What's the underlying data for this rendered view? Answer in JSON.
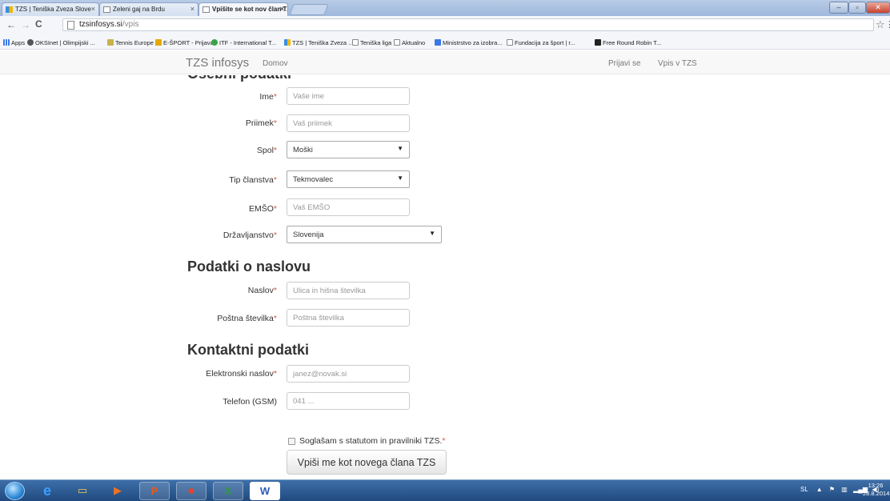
{
  "browser": {
    "tabs": [
      {
        "title": "TZS | Teniška Zveza Slove",
        "active": false
      },
      {
        "title": "Zeleni gaj na Brdu",
        "active": false
      },
      {
        "title": "Vpišite se kot nov član TZ",
        "active": true
      }
    ],
    "url_host": "tzsinfosys.si",
    "url_path": "/vpis",
    "bookmarks": [
      "Apps",
      "OKSInet | Olimpijski ...",
      "Tennis Europe",
      "E-ŠPORT - Prijava",
      "ITF - International T...",
      "TZS | Teniška Zveza ...",
      "Teniška liga",
      "Aktualno",
      "Ministrstvo za izobra...",
      "Fundacija za šport | r...",
      "Free Round Robin T..."
    ]
  },
  "navbar": {
    "brand": "TZS infosys",
    "home": "Domov",
    "login": "Prijavi se",
    "register": "Vpis v TZS"
  },
  "form": {
    "personal": {
      "heading": "Osebni podatki",
      "first_name": {
        "label": "Ime",
        "placeholder": "Vaše ime"
      },
      "last_name": {
        "label": "Priimek",
        "placeholder": "Vaš priimek"
      },
      "gender": {
        "label": "Spol",
        "value": "Moški"
      },
      "membership": {
        "label": "Tip članstva",
        "value": "Tekmovalec"
      },
      "emso": {
        "label": "EMŠO",
        "placeholder": "Vaš EMŠO"
      },
      "citizenship": {
        "label": "Državljanstvo",
        "value": "Slovenija"
      }
    },
    "address": {
      "heading": "Podatki o naslovu",
      "street": {
        "label": "Naslov",
        "placeholder": "Ulica in hišna številka"
      },
      "postal": {
        "label": "Poštna številka",
        "placeholder": "Poštna številka"
      }
    },
    "contact": {
      "heading": "Kontaktni podatki",
      "email": {
        "label": "Elektronski naslov",
        "placeholder": "janez@novak.si"
      },
      "phone": {
        "label": "Telefon (GSM)",
        "placeholder": "041 ..."
      }
    },
    "required_mark": "*",
    "agree_label": "Soglašam s statutom in pravilniki TZS.",
    "submit_label": "Vpiši me kot novega člana TZS"
  },
  "taskbar": {
    "language": "SL",
    "time": "13:26",
    "date": "28.8.2014"
  },
  "colors": {
    "required": "#d9534f",
    "taskbar": "#1f4a80",
    "navbar_bg": "#f8f8f8"
  }
}
